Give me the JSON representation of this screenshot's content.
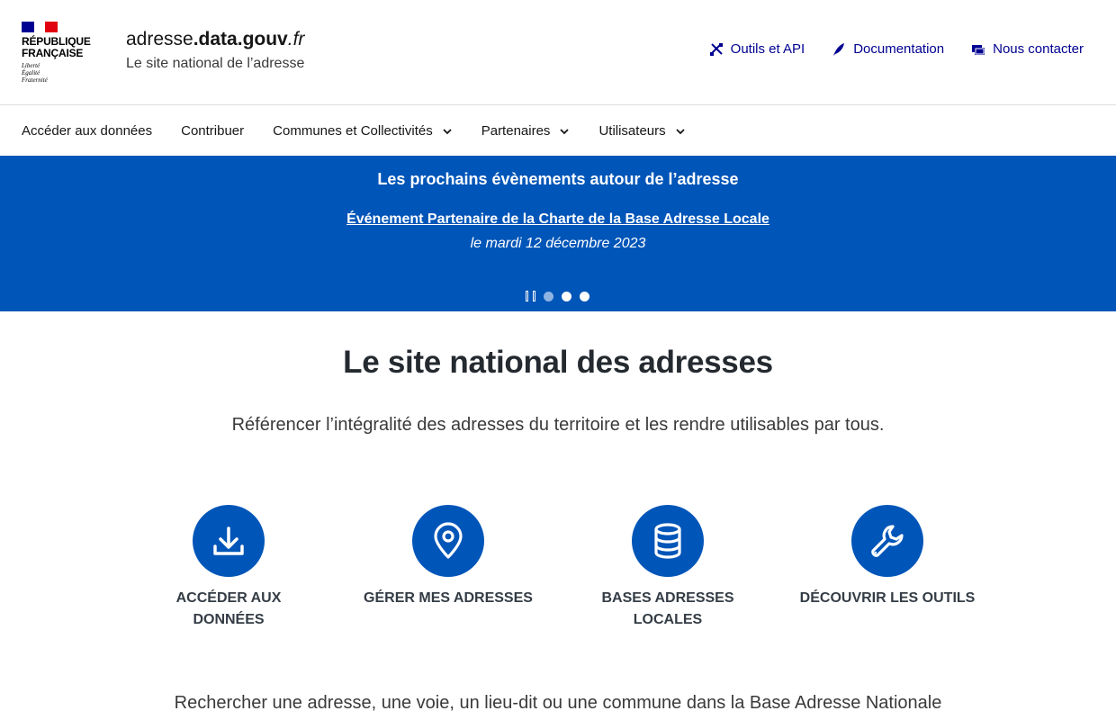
{
  "header": {
    "logo_text": "RÉPUBLIQUE\nFRANÇAISE",
    "devise": "Liberté\nÉgalité\nFraternité",
    "site_name_prefix": "adresse",
    "site_name_bold": ".data.gouv",
    "site_name_suffix": ".fr",
    "tagline": "Le site national de l’adresse",
    "quick_links": [
      {
        "label": "Outils et API",
        "icon": "tools-icon"
      },
      {
        "label": "Documentation",
        "icon": "quill-icon"
      },
      {
        "label": "Nous contacter",
        "icon": "chat-icon"
      }
    ]
  },
  "nav": {
    "items": [
      {
        "label": "Accéder aux données",
        "dropdown": false
      },
      {
        "label": "Contribuer",
        "dropdown": false
      },
      {
        "label": "Communes et Collectivités",
        "dropdown": true
      },
      {
        "label": "Partenaires",
        "dropdown": true
      },
      {
        "label": "Utilisateurs",
        "dropdown": true
      }
    ]
  },
  "banner": {
    "title": "Les prochains évènements autour de l’adresse",
    "event_link": "Événement Partenaire de la Charte de la Base Adresse Locale",
    "event_date": "le mardi 12 décembre 2023",
    "slides_count": 3,
    "active_slide": 1
  },
  "main": {
    "title": "Le site national des adresses",
    "subtitle": "Référencer l’intégralité des adresses du territoire et les rendre utilisables par tous.",
    "cards": [
      {
        "label": "ACCÉDER AUX DONNÉES",
        "icon": "download-icon"
      },
      {
        "label": "GÉRER MES ADRESSES",
        "icon": "map-pin-icon"
      },
      {
        "label": "BASES ADRESSES LOCALES",
        "icon": "database-icon"
      },
      {
        "label": "DÉCOUVRIR LES OUTILS",
        "icon": "wrench-icon"
      }
    ],
    "search_label": "Rechercher une adresse, une voie, un lieu-dit ou une commune dans la Base Adresse Nationale"
  },
  "colors": {
    "primary_blue": "#0055b8",
    "link_blue": "#000091",
    "flag_blue": "#000091",
    "flag_red": "#e1000f"
  }
}
